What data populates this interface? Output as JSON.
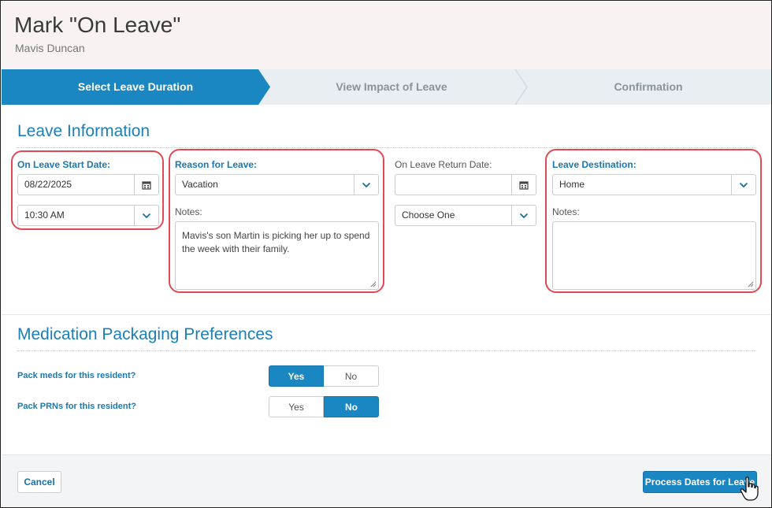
{
  "header": {
    "title": "Mark \"On Leave\"",
    "subtitle": "Mavis Duncan"
  },
  "steps": [
    {
      "label": "Select Leave Duration",
      "active": true
    },
    {
      "label": "View Impact of Leave",
      "active": false
    },
    {
      "label": "Confirmation",
      "active": false
    }
  ],
  "leave_info": {
    "section_title": "Leave Information",
    "start_date": {
      "label": "On Leave Start Date:",
      "date_value": "08/22/2025",
      "time_value": "10:30 AM"
    },
    "reason": {
      "label": "Reason for Leave:",
      "value": "Vacation",
      "notes_label": "Notes:",
      "notes_value": "Mavis's son Martin is picking her up to spend the week with their family."
    },
    "return_date": {
      "label": "On Leave Return Date:",
      "date_value": "",
      "time_value": "Choose One"
    },
    "destination": {
      "label": "Leave Destination:",
      "value": "Home",
      "notes_label": "Notes:",
      "notes_value": ""
    }
  },
  "med_pack": {
    "section_title": "Medication Packaging Preferences",
    "pack_meds": {
      "label": "Pack meds for this resident?",
      "yes": "Yes",
      "no": "No",
      "selected": "Yes"
    },
    "pack_prns": {
      "label": "Pack PRNs for this resident?",
      "yes": "Yes",
      "no": "No",
      "selected": "No"
    }
  },
  "footer": {
    "cancel_label": "Cancel",
    "process_label": "Process Dates for Leave"
  },
  "colors": {
    "accent": "#1a86c2",
    "highlight": "#e04a55",
    "title_blue": "#1b7fb5"
  }
}
